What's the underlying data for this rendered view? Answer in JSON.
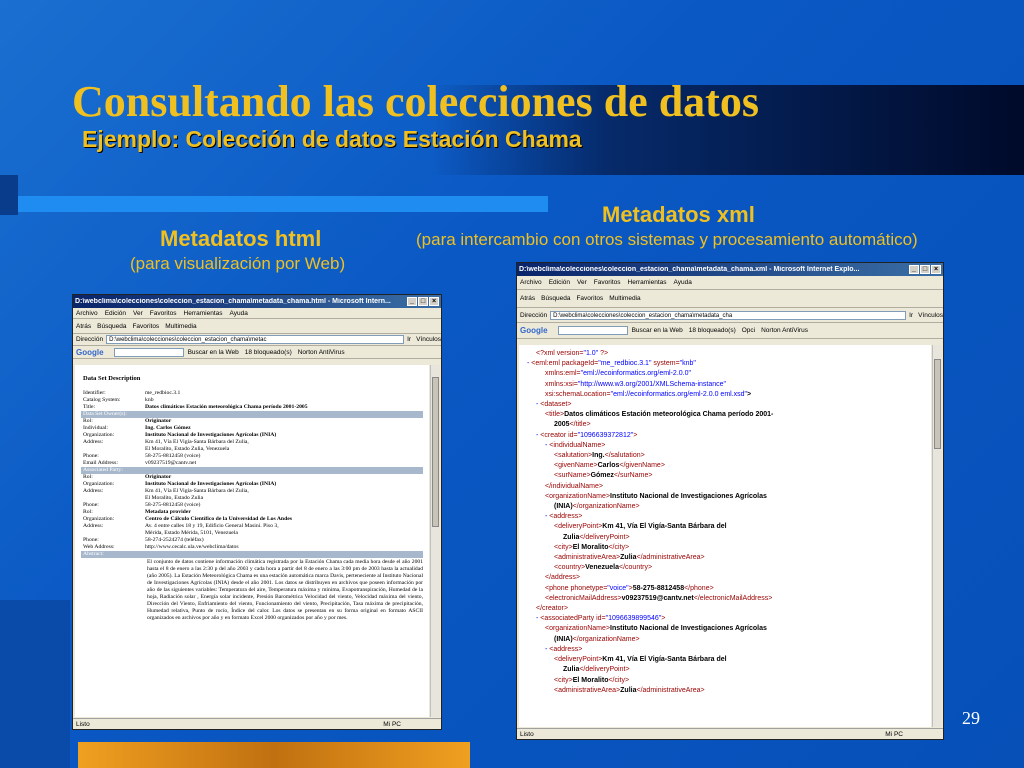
{
  "slide": {
    "title": "Consultando las colecciones de datos",
    "subtitle": "Ejemplo: Colección de datos Estación Chama",
    "html_heading": "Metadatos html",
    "html_sub": "(para visualización por Web)",
    "xml_heading": "Metadatos xml",
    "xml_sub": "(para intercambio con otros sistemas y procesamiento automático)",
    "page_number": "29"
  },
  "browser_html": {
    "title": "D:\\webclima\\colecciones\\coleccion_estacion_chama\\metadata_chama.html - Microsoft Intern...",
    "menu": [
      "Archivo",
      "Edición",
      "Ver",
      "Favoritos",
      "Herramientas",
      "Ayuda"
    ],
    "toolbar": [
      "Atrás",
      "Búsqueda",
      "Favoritos",
      "Multimedia"
    ],
    "address_label": "Dirección",
    "address": "D:\\webclima\\colecciones\\coleccion_estacion_chama\\metac",
    "go": "Ir",
    "links": "Vínculos",
    "google_bar": [
      "Buscar en la Web",
      "18 bloqueado(s)",
      "Norton AntiVirus"
    ],
    "status_left": "Listo",
    "status_right": "Mi PC",
    "ds_title": "Data Set Description",
    "rows": [
      {
        "k": "Identifier:",
        "v": "me_redbioc.3.1",
        "bold": false,
        "sec": false
      },
      {
        "k": "Catalog System:",
        "v": "knb",
        "bold": false,
        "sec": false
      },
      {
        "k": "Title:",
        "v": "Datos climáticos Estación meteorológica Chama período 2001-2005",
        "bold": true,
        "sec": false
      },
      {
        "k": "Data Set Owner(s):",
        "v": "",
        "bold": false,
        "sec": true
      },
      {
        "k": "Rol:",
        "v": "Originator",
        "bold": true,
        "sec": false
      },
      {
        "k": "Individual:",
        "v": "Ing. Carlos Gómez",
        "bold": true,
        "sec": false
      },
      {
        "k": "Organization:",
        "v": "Instituto Nacional de Investigaciones Agrícolas (INIA)",
        "bold": true,
        "sec": false
      },
      {
        "k": "Address:",
        "v": "Km 41, Vía El Vigía-Santa Bárbara del Zulia,",
        "bold": false,
        "sec": false
      },
      {
        "k": "",
        "v": "El Moralito, Estado Zulia, Venezuela",
        "bold": false,
        "sec": false
      },
      {
        "k": "Phone:",
        "v": "58-275-8812458 (voice)",
        "bold": false,
        "sec": false
      },
      {
        "k": "Email Address:",
        "v": "v09237519@cantv.net",
        "bold": false,
        "sec": false
      },
      {
        "k": "Associated Party:",
        "v": "",
        "bold": false,
        "sec": true
      },
      {
        "k": "Rol:",
        "v": "Originator",
        "bold": true,
        "sec": false
      },
      {
        "k": "Organization:",
        "v": "Instituto Nacional de Investigaciones Agrícolas (INIA)",
        "bold": true,
        "sec": false
      },
      {
        "k": "Address:",
        "v": "Km 41, Vía El Vigía-Santa Bárbara del Zulia,",
        "bold": false,
        "sec": false
      },
      {
        "k": "",
        "v": "El Moralito, Estado Zulia",
        "bold": false,
        "sec": false
      },
      {
        "k": "Phone:",
        "v": "58-275-8812458 (voice)",
        "bold": false,
        "sec": false
      },
      {
        "k": "Rol:",
        "v": "Metadata provider",
        "bold": true,
        "sec": false
      },
      {
        "k": "Organization:",
        "v": "Centro de Cálculo Científico de la Universidad de Los Andes",
        "bold": true,
        "sec": false
      },
      {
        "k": "Address:",
        "v": "Av. 4 entre calles 18 y 19, Edificio General Masini. Piso 3,",
        "bold": false,
        "sec": false
      },
      {
        "k": "",
        "v": "Mérida, Estado Mérida, 5101, Venezuela",
        "bold": false,
        "sec": false
      },
      {
        "k": "Phone:",
        "v": "58-274-2524274 (teléfax)",
        "bold": false,
        "sec": false
      },
      {
        "k": "Web Address:",
        "v": "http://www.cecalc.ula.ve/webclima/datos",
        "bold": false,
        "sec": false
      },
      {
        "k": "Abstract:",
        "v": "",
        "bold": false,
        "sec": true
      }
    ],
    "abstract": "El conjunto de datos contiene información climática registrada por la Estación Chama cada media hora desde el año 2001 hasta el 8 de enero a las 2:30 p del año 2003 y cada hora a partir del 8 de enero a las 3:00 pm de 2003 hasta la actualidad (año 2005). La Estación Meteorológica Chama es una estación automática marca Davis, perteneciente al Instituto Nacional de Investigaciones Agrícolas (INIA) desde el año 2001. Los datos se distribuyen en archivos que poseen información por año de las siguientes variables: Temperatura del aire, Temperatura máxima y mínima, Evapotranspiración, Humedad de la hoja, Radiación solar , Energía solar incidente, Presión Barométrica Velocidad del viento, Velocidad máxima del viento, Dirección del Viento, Enfriamiento del viento, Funcionamiento del viento, Precipitación, Tasa máxima de precipitación, Humedad relativa, Punto de rocío, Índice del calor. Los datos se presentan en su forma original en formato ASCII organizados en archivos por año y en formato Excel 2000 organizados por año y por mes."
  },
  "browser_xml": {
    "title": "D:\\webclima\\colecciones\\coleccion_estacion_chama\\metadata_chama.xml - Microsoft Internet Explo...",
    "menu": [
      "Archivo",
      "Edición",
      "Ver",
      "Favoritos",
      "Herramientas",
      "Ayuda"
    ],
    "toolbar": [
      "Atrás",
      "Búsqueda",
      "Favoritos",
      "Multimedia"
    ],
    "address_label": "Dirección",
    "address": "D:\\webclima\\colecciones\\coleccion_estacion_chama\\metadata_cha",
    "go": "Ir",
    "links": "Vínculos",
    "google_bar": [
      "Buscar en la Web",
      "18 bloqueado(s)",
      "Opci",
      "Norton AntiVirus"
    ],
    "status_left": "Listo",
    "status_right": "Mi PC",
    "lines": [
      {
        "i": 1,
        "m": "",
        "t": "<?xml version=\"1.0\" ?>"
      },
      {
        "i": 0,
        "m": "-",
        "t": "<eml:eml packageId=\"me_redbioc.3.1\" system=\"knb\""
      },
      {
        "i": 2,
        "m": "",
        "t": "xmlns:eml=\"eml://ecoinformatics.org/eml-2.0.0\""
      },
      {
        "i": 2,
        "m": "",
        "t": "xmlns:xsi=\"http://www.w3.org/2001/XMLSchema-instance\""
      },
      {
        "i": 2,
        "m": "",
        "t": "xsi:schemaLocation=\"eml://ecoinformatics.org/eml-2.0.0 eml.xsd\">"
      },
      {
        "i": 1,
        "m": "-",
        "t": "<dataset>"
      },
      {
        "i": 2,
        "m": "",
        "t": "<title>Datos climáticos Estación meteorológica Chama período 2001-"
      },
      {
        "i": 3,
        "m": "",
        "t": "2005</title>"
      },
      {
        "i": 1,
        "m": "-",
        "t": "<creator id=\"1096639372812\">"
      },
      {
        "i": 2,
        "m": "-",
        "t": "<individualName>"
      },
      {
        "i": 3,
        "m": "",
        "t": "<salutation>Ing.</salutation>"
      },
      {
        "i": 3,
        "m": "",
        "t": "<givenName>Carlos</givenName>"
      },
      {
        "i": 3,
        "m": "",
        "t": "<surName>Gómez</surName>"
      },
      {
        "i": 2,
        "m": "",
        "t": "</individualName>"
      },
      {
        "i": 2,
        "m": "",
        "t": "<organizationName>Instituto Nacional de Investigaciones Agrícolas"
      },
      {
        "i": 3,
        "m": "",
        "t": "(INIA)</organizationName>"
      },
      {
        "i": 2,
        "m": "-",
        "t": "<address>"
      },
      {
        "i": 3,
        "m": "",
        "t": "<deliveryPoint>Km 41, Vía El Vigía-Santa Bárbara del"
      },
      {
        "i": 4,
        "m": "",
        "t": "Zulia</deliveryPoint>"
      },
      {
        "i": 3,
        "m": "",
        "t": "<city>El Moralito</city>"
      },
      {
        "i": 3,
        "m": "",
        "t": "<administrativeArea>Zulia</administrativeArea>"
      },
      {
        "i": 3,
        "m": "",
        "t": "<country>Venezuela</country>"
      },
      {
        "i": 2,
        "m": "",
        "t": "</address>"
      },
      {
        "i": 2,
        "m": "",
        "t": "<phone phonetype=\"voice\">58-275-8812458</phone>"
      },
      {
        "i": 2,
        "m": "",
        "t": "<electronicMailAddress>v09237519@cantv.net</electronicMailAddress>"
      },
      {
        "i": 1,
        "m": "",
        "t": "</creator>"
      },
      {
        "i": 1,
        "m": "-",
        "t": "<associatedParty id=\"1096639899546\">"
      },
      {
        "i": 2,
        "m": "",
        "t": "<organizationName>Instituto Nacional de Investigaciones Agrícolas"
      },
      {
        "i": 3,
        "m": "",
        "t": "(INIA)</organizationName>"
      },
      {
        "i": 2,
        "m": "-",
        "t": "<address>"
      },
      {
        "i": 3,
        "m": "",
        "t": "<deliveryPoint>Km 41, Vía El Vigía-Santa Bárbara del"
      },
      {
        "i": 4,
        "m": "",
        "t": "Zulia</deliveryPoint>"
      },
      {
        "i": 3,
        "m": "",
        "t": "<city>El Moralito</city>"
      },
      {
        "i": 3,
        "m": "",
        "t": "<administrativeArea>Zulia</administrativeArea>"
      }
    ]
  }
}
